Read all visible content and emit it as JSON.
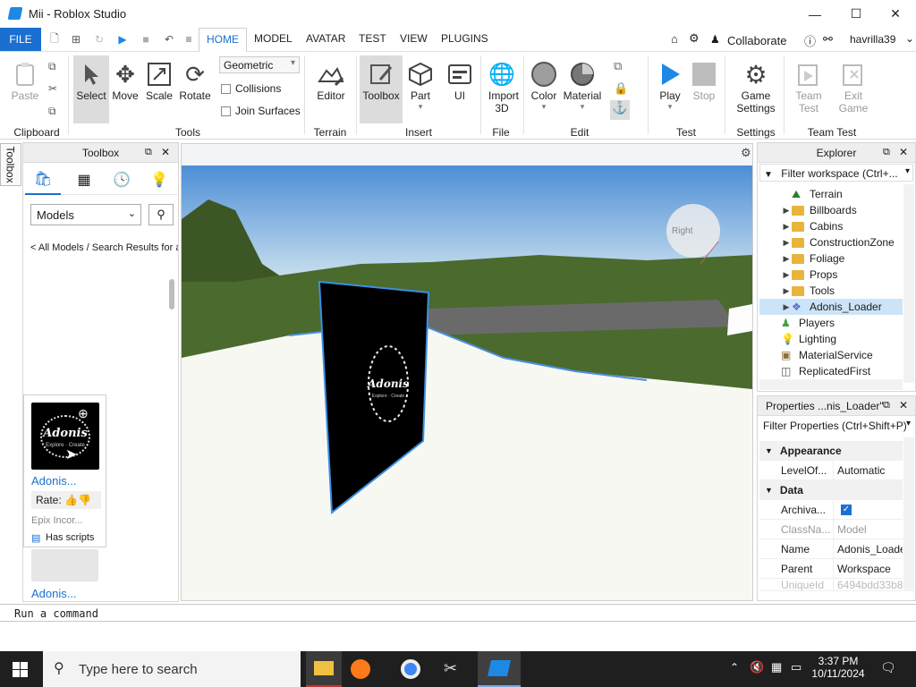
{
  "window": {
    "title": "Mii - Roblox Studio"
  },
  "menu": {
    "file": "FILE",
    "tabs": [
      "HOME",
      "MODEL",
      "AVATAR",
      "TEST",
      "VIEW",
      "PLUGINS"
    ],
    "collaborate": "Collaborate",
    "user": "havrilla39"
  },
  "ribbon": {
    "clipboard": {
      "paste": "Paste",
      "group": "Clipboard"
    },
    "tools": {
      "select": "Select",
      "move": "Move",
      "scale": "Scale",
      "rotate": "Rotate",
      "group": "Tools"
    },
    "options": {
      "mode": "Geometric",
      "collisions": "Collisions",
      "join_surfaces": "Join Surfaces"
    },
    "terrain": {
      "editor": "Editor",
      "group": "Terrain"
    },
    "insert": {
      "toolbox": "Toolbox",
      "part": "Part",
      "ui": "UI",
      "group": "Insert"
    },
    "file": {
      "import": "Import 3D",
      "group": "File"
    },
    "edit": {
      "color": "Color",
      "material": "Material",
      "group": "Edit"
    },
    "test": {
      "play": "Play",
      "stop": "Stop",
      "group": "Test"
    },
    "settings": {
      "game": "Game Settings",
      "group": "Settings"
    },
    "team_test": {
      "team": "Team Test",
      "exit": "Exit Game",
      "group": "Team Test"
    }
  },
  "toolbox": {
    "tab_label": "Toolbox",
    "title": "Toolbox",
    "category": "Models",
    "breadcrumb": "< All Models / Search Results for a",
    "item": {
      "name": "Adonis...",
      "rate_label": "Rate:",
      "creator": "Epix Incor...",
      "scripts": "Has scripts",
      "thumb_text": "Adonis",
      "thumb_sub": "Explore · Create"
    },
    "item2": {
      "name": "Adonis..."
    }
  },
  "viewport": {
    "board_text": "Adonis",
    "board_sub": "Explore · Create",
    "gizmo_label": "Right"
  },
  "explorer": {
    "title": "Explorer",
    "filter": "Filter workspace (Ctrl+...",
    "items": [
      {
        "label": "Terrain",
        "indent": 2,
        "icon": "terrain",
        "arrow": false
      },
      {
        "label": "Billboards",
        "indent": 2,
        "icon": "folder",
        "arrow": true
      },
      {
        "label": "Cabins",
        "indent": 2,
        "icon": "folder",
        "arrow": true
      },
      {
        "label": "ConstructionZone",
        "indent": 2,
        "icon": "folder",
        "arrow": true
      },
      {
        "label": "Foliage",
        "indent": 2,
        "icon": "folder",
        "arrow": true
      },
      {
        "label": "Props",
        "indent": 2,
        "icon": "folder",
        "arrow": true
      },
      {
        "label": "Tools",
        "indent": 2,
        "icon": "folder",
        "arrow": true
      },
      {
        "label": "Adonis_Loader",
        "indent": 2,
        "icon": "model",
        "arrow": true,
        "selected": true
      },
      {
        "label": "Players",
        "indent": 1,
        "icon": "players",
        "arrow": false
      },
      {
        "label": "Lighting",
        "indent": 1,
        "icon": "lighting",
        "arrow": false
      },
      {
        "label": "MaterialService",
        "indent": 1,
        "icon": "material",
        "arrow": false
      },
      {
        "label": "ReplicatedFirst",
        "indent": 1,
        "icon": "replicated",
        "arrow": false
      }
    ]
  },
  "properties": {
    "title": "Properties ...nis_Loader\"",
    "filter": "Filter Properties (Ctrl+Shift+P)",
    "appearance": "Appearance",
    "level_key": "LevelOf...",
    "level_val": "Automatic",
    "data": "Data",
    "archivable_key": "Archiva...",
    "classname_key": "ClassNa...",
    "classname_val": "Model",
    "name_key": "Name",
    "name_val": "Adonis_Loader",
    "parent_key": "Parent",
    "parent_val": "Workspace",
    "uniqueid_key": "UniqueId",
    "uniqueid_val": "6494bdd33b8c"
  },
  "command": {
    "placeholder": "Run a command"
  },
  "taskbar": {
    "search": "Type here to search",
    "time": "3:37 PM",
    "date": "10/11/2024"
  },
  "colors": {
    "accent": "#1a6fd1",
    "selection": "#cce4f7",
    "play": "#1e88e5"
  }
}
